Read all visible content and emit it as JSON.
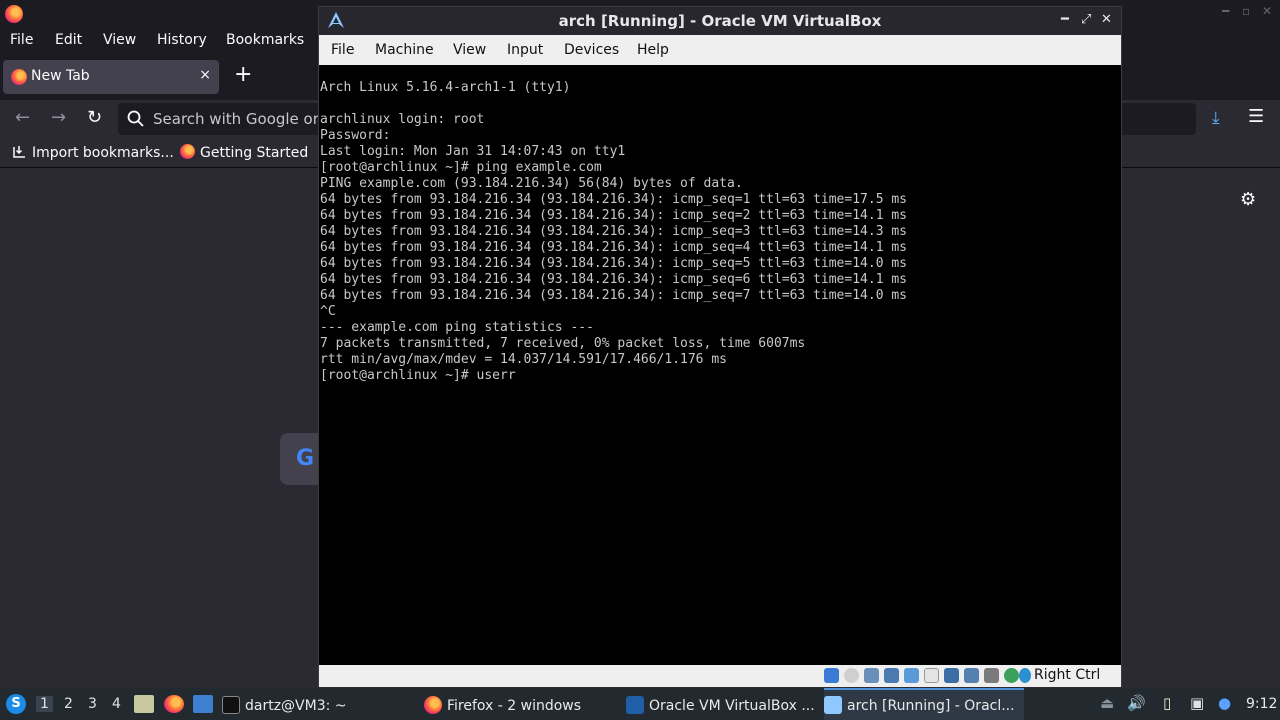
{
  "firefox": {
    "menus": [
      "File",
      "Edit",
      "View",
      "History",
      "Bookmarks"
    ],
    "tab_label": "New Tab",
    "tab_close": "×",
    "new_tab": "+",
    "url_placeholder": "Search with Google or e",
    "bookmarks": [
      "Import bookmarks...",
      "Getting Started"
    ]
  },
  "vbox": {
    "title": "arch [Running] - Oracle VM VirtualBox",
    "menus": [
      "File",
      "Machine",
      "View",
      "Input",
      "Devices",
      "Help"
    ],
    "host_key": "Right Ctrl",
    "terminal_lines": [
      "Arch Linux 5.16.4-arch1-1 (tty1)",
      "",
      "archlinux login: root",
      "Password:",
      "Last login: Mon Jan 31 14:07:43 on tty1",
      "[root@archlinux ~]# ping example.com",
      "PING example.com (93.184.216.34) 56(84) bytes of data.",
      "64 bytes from 93.184.216.34 (93.184.216.34): icmp_seq=1 ttl=63 time=17.5 ms",
      "64 bytes from 93.184.216.34 (93.184.216.34): icmp_seq=2 ttl=63 time=14.1 ms",
      "64 bytes from 93.184.216.34 (93.184.216.34): icmp_seq=3 ttl=63 time=14.3 ms",
      "64 bytes from 93.184.216.34 (93.184.216.34): icmp_seq=4 ttl=63 time=14.1 ms",
      "64 bytes from 93.184.216.34 (93.184.216.34): icmp_seq=5 ttl=63 time=14.0 ms",
      "64 bytes from 93.184.216.34 (93.184.216.34): icmp_seq=6 ttl=63 time=14.1 ms",
      "64 bytes from 93.184.216.34 (93.184.216.34): icmp_seq=7 ttl=63 time=14.0 ms",
      "^C",
      "--- example.com ping statistics ---",
      "7 packets transmitted, 7 received, 0% packet loss, time 6007ms",
      "rtt min/avg/max/mdev = 14.037/14.591/17.466/1.176 ms",
      "[root@archlinux ~]# userr"
    ]
  },
  "taskbar": {
    "desktops": [
      "1",
      "2",
      "3",
      "4"
    ],
    "tasks": [
      "dartz@VM3: ~",
      "Firefox - 2 windows",
      "Oracle VM VirtualBox ...",
      "arch [Running] - Oracl..."
    ],
    "clock": "9:12"
  },
  "colors": {
    "accent": "#4a90d9",
    "console_bg": "#000000",
    "console_fg": "#c8c8c8"
  }
}
